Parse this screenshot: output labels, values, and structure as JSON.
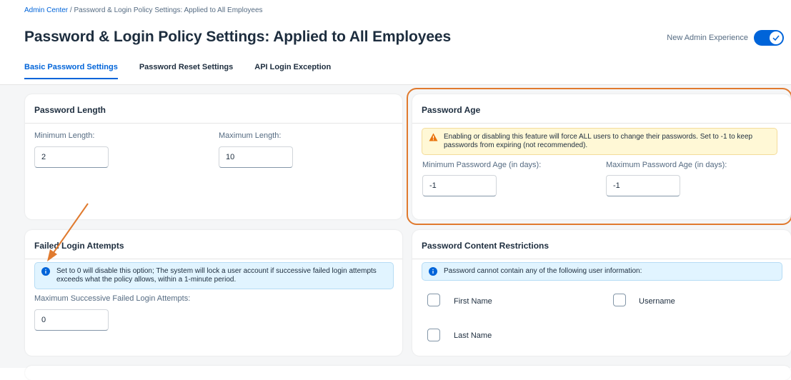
{
  "breadcrumb": {
    "link": "Admin Center",
    "separator": " / ",
    "current": "Password & Login Policy Settings: Applied to All Employees"
  },
  "page_title": "Password & Login Policy Settings: Applied to All Employees",
  "admin_toggle": {
    "label": "New Admin Experience",
    "enabled": true
  },
  "tabs": [
    {
      "label": "Basic Password Settings",
      "active": true
    },
    {
      "label": "Password Reset Settings",
      "active": false
    },
    {
      "label": "API Login Exception",
      "active": false
    }
  ],
  "password_length": {
    "title": "Password Length",
    "min_label": "Minimum Length:",
    "min_value": "2",
    "max_label": "Maximum Length:",
    "max_value": "10"
  },
  "password_age": {
    "title": "Password Age",
    "warning": "Enabling or disabling this feature will force ALL users to change their passwords. Set to -1 to keep passwords from expiring (not recommended).",
    "min_label": "Minimum Password Age (in days):",
    "min_value": "-1",
    "max_label": "Maximum Password Age (in days):",
    "max_value": "-1"
  },
  "failed_login": {
    "title": "Failed Login Attempts",
    "info": "Set to 0 will disable this option; The system will lock a user account if successive failed login attempts exceeds what the policy allows, within a 1-minute period.",
    "max_label": "Maximum Successive Failed Login Attempts:",
    "max_value": "0"
  },
  "content_restrictions": {
    "title": "Password Content Restrictions",
    "info": "Password cannot contain any of the following user information:",
    "options": [
      {
        "label": "First Name",
        "checked": false
      },
      {
        "label": "Username",
        "checked": false
      },
      {
        "label": "Last Name",
        "checked": false
      }
    ]
  },
  "colors": {
    "accent": "#0064d9",
    "annotation": "#e07a2e",
    "warning_bg": "#fff8d6",
    "info_bg": "#e1f4ff"
  },
  "icons": {
    "warning": "warning-triangle-icon",
    "info": "info-icon",
    "toggle_check": "checkmark-icon"
  }
}
